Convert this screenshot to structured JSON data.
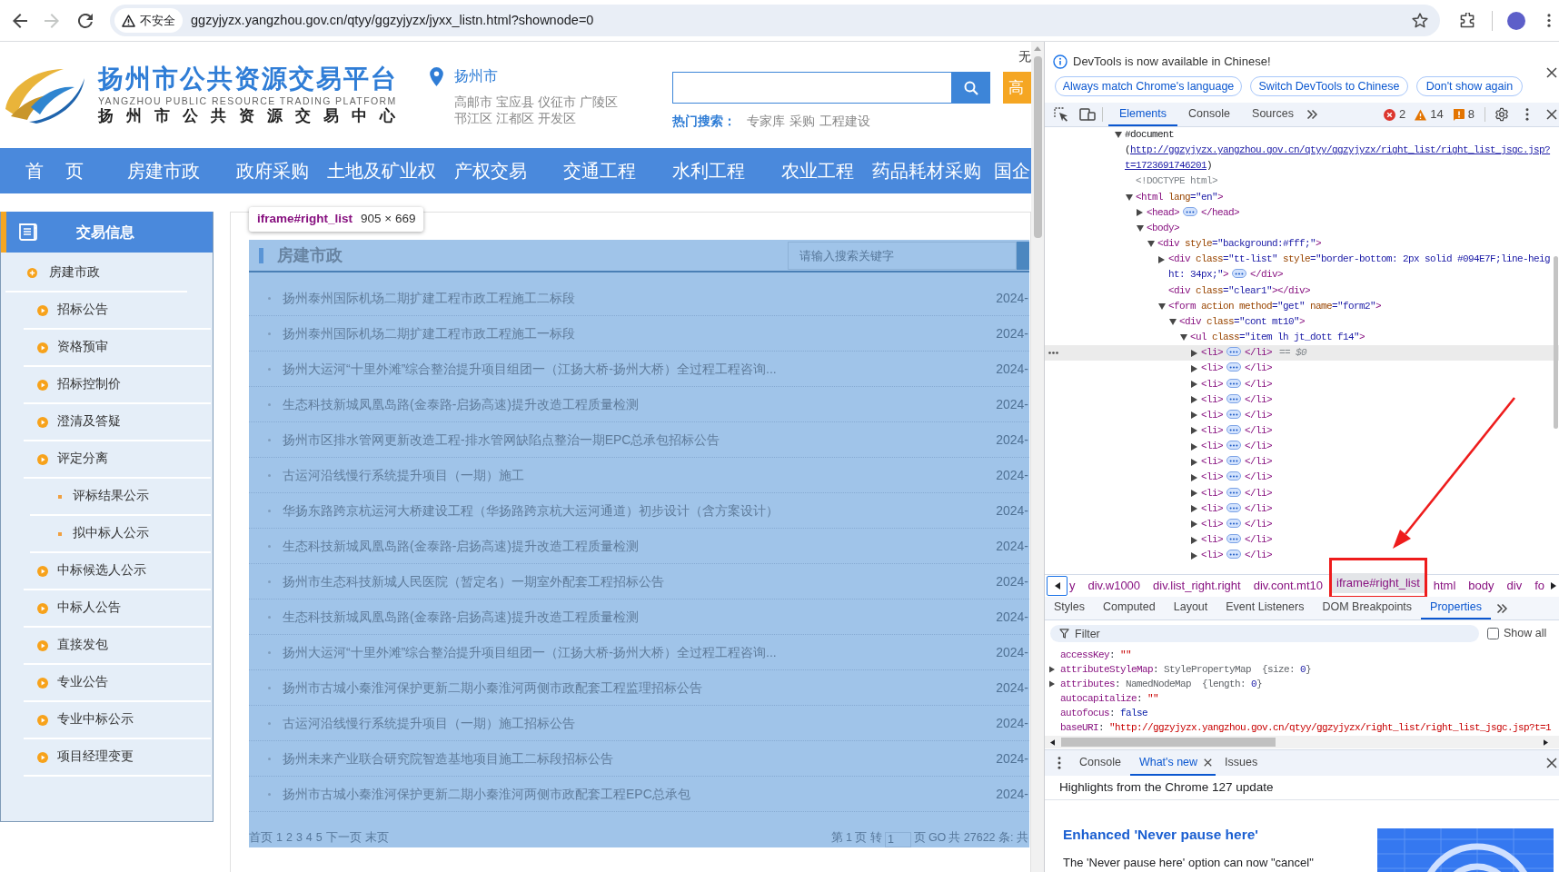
{
  "browser": {
    "forward_disabled": true,
    "security_label": "不安全",
    "url": "ggzyjyzx.yangzhou.gov.cn/qtyy/ggzyjyzx/jyxx_listn.html?shownode=0"
  },
  "site_header": {
    "title": "扬州市公共资源交易平台",
    "title_en": "YANGZHOU PUBLIC RESOURCE TRADING PLATFORM",
    "title_center": "扬州市公共资源交易中心",
    "city": "扬州市",
    "districts": [
      "高邮市",
      "宝应县",
      "仪征市",
      "广陵区",
      "邗江区",
      "江都区",
      "开发区"
    ],
    "corner_text": "无",
    "advanced_search_label": "高",
    "hot_search_label": "热门搜索：",
    "hot_search_terms": [
      "专家库",
      "采购",
      "工程建设"
    ]
  },
  "nav": [
    "首 页",
    "房建市政",
    "政府采购",
    "土地及矿业权",
    "产权交易",
    "交通工程",
    "水利工程",
    "农业工程",
    "药品耗材采购",
    "国企"
  ],
  "sidebar": {
    "title": "交易信息",
    "items": [
      {
        "label": "房建市政",
        "children": [
          {
            "label": "招标公告"
          },
          {
            "label": "资格预审"
          },
          {
            "label": "招标控制价"
          },
          {
            "label": "澄清及答疑"
          },
          {
            "label": "评定分离",
            "children": [
              {
                "label": "评标结果公示"
              },
              {
                "label": "拟中标人公示"
              }
            ]
          },
          {
            "label": "中标候选人公示"
          },
          {
            "label": "中标人公告"
          },
          {
            "label": "直接发包"
          },
          {
            "label": "专业公告"
          },
          {
            "label": "专业中标公示"
          },
          {
            "label": "项目经理变更"
          }
        ]
      }
    ]
  },
  "list_panel": {
    "inspect_tooltip": {
      "selector": "iframe#right_list",
      "size": "905 × 669"
    },
    "title": "房建市政",
    "search_placeholder": "请输入搜索关键字",
    "rows": [
      {
        "title": "扬州泰州国际机场二期扩建工程市政工程施工二标段",
        "date": "2024-"
      },
      {
        "title": "扬州泰州国际机场二期扩建工程市政工程施工一标段",
        "date": "2024-"
      },
      {
        "title": "扬州大运河“十里外滩”综合整治提升项目组团一（江扬大桥-扬州大桥）全过程工程咨询...",
        "date": "2024-"
      },
      {
        "title": "生态科技新城凤凰岛路(金泰路-启扬高速)提升改造工程质量检测",
        "date": "2024-"
      },
      {
        "title": "扬州市区排水管网更新改造工程-排水管网缺陷点整治一期EPC总承包招标公告",
        "date": "2024-"
      },
      {
        "title": "古运河沿线慢行系统提升项目（一期）施工",
        "date": "2024-"
      },
      {
        "title": "华扬东路跨京杭运河大桥建设工程（华扬路跨京杭大运河通道）初步设计（含方案设计）",
        "date": "2024-"
      },
      {
        "title": "生态科技新城凤凰岛路(金泰路-启扬高速)提升改造工程质量检测",
        "date": "2024-"
      },
      {
        "title": "扬州市生态科技新城人民医院（暂定名）一期室外配套工程招标公告",
        "date": "2024-"
      },
      {
        "title": "生态科技新城凤凰岛路(金泰路-启扬高速)提升改造工程质量检测",
        "date": "2024-"
      },
      {
        "title": "扬州大运河“十里外滩”综合整治提升项目组团一（江扬大桥-扬州大桥）全过程工程咨询...",
        "date": "2024-"
      },
      {
        "title": "扬州市古城小秦淮河保护更新二期小秦淮河两侧市政配套工程监理招标公告",
        "date": "2024-"
      },
      {
        "title": "古运河沿线慢行系统提升项目（一期）施工招标公告",
        "date": "2024-"
      },
      {
        "title": "扬州未来产业联合研究院智造基地项目施工二标段招标公告",
        "date": "2024-"
      },
      {
        "title": "扬州市古城小秦淮河保护更新二期小秦淮河两侧市政配套工程EPC总承包",
        "date": "2024-"
      }
    ],
    "pagination": {
      "pages": [
        "首页",
        "1",
        "2",
        "3",
        "4",
        "5",
        "下一页",
        "末页"
      ],
      "page_status": "第 1 页 转",
      "jump_value": "1",
      "jump_suffix": "页",
      "go_label": "GO",
      "total": "共 27622 条: 共"
    }
  },
  "devtools": {
    "notice": {
      "message": "DevTools is now available in Chinese!",
      "buttons": [
        "Always match Chrome's language",
        "Switch DevTools to Chinese",
        "Don't show again"
      ]
    },
    "tabs": [
      {
        "label": "Elements",
        "selected": true
      },
      {
        "label": "Console",
        "selected": false
      },
      {
        "label": "Sources",
        "selected": false
      }
    ],
    "issue_counts": [
      {
        "kind": "error",
        "count": "2"
      },
      {
        "kind": "warning",
        "count": "14"
      },
      {
        "kind": "issue",
        "count": "8"
      }
    ],
    "dom_tree": [
      {
        "selected": false,
        "expanded": true,
        "tokens": [
          {
            "kind": "plain",
            "text": "#document"
          },
          {
            "kind": "break"
          },
          {
            "kind": "plain",
            "text": "("
          },
          {
            "kind": "link",
            "text": "http://ggzyjyzx.yangzhou.gov.cn/qtyy/ggzyjyzx/right_list/right_list_jsgc.jsp?t=1723691746201"
          },
          {
            "kind": "plain",
            "text": ")"
          }
        ],
        "children": [
          {
            "selected": false,
            "tokens": [
              {
                "kind": "doctype",
                "text": "<!DOCTYPE html>"
              }
            ]
          },
          {
            "selected": false,
            "expanded": true,
            "tokens": [
              {
                "kind": "tag",
                "text": "<html"
              },
              {
                "kind": "attr",
                "text": " lang"
              },
              {
                "kind": "value",
                "text": "=\"en\""
              },
              {
                "kind": "tag",
                "text": ">"
              }
            ],
            "children": [
              {
                "selected": false,
                "expanded": false,
                "tokens": [
                  {
                    "kind": "tag",
                    "text": "<head>"
                  },
                  {
                    "kind": "ellipsis"
                  },
                  {
                    "kind": "tag",
                    "text": "</head>"
                  }
                ]
              },
              {
                "selected": false,
                "expanded": true,
                "tokens": [
                  {
                    "kind": "tag",
                    "text": "<body>"
                  }
                ],
                "children": [
                  {
                    "selected": false,
                    "expanded": true,
                    "tokens": [
                      {
                        "kind": "tag",
                        "text": "<div"
                      },
                      {
                        "kind": "attr",
                        "text": " style"
                      },
                      {
                        "kind": "value",
                        "text": "=\"background:#fff;\""
                      },
                      {
                        "kind": "tag",
                        "text": ">"
                      }
                    ],
                    "children": [
                      {
                        "selected": false,
                        "expanded": false,
                        "tokens": [
                          {
                            "kind": "tag",
                            "text": "<div"
                          },
                          {
                            "kind": "attr",
                            "text": " class"
                          },
                          {
                            "kind": "value",
                            "text": "=\"tt-list\""
                          },
                          {
                            "kind": "attr",
                            "text": " style"
                          },
                          {
                            "kind": "value",
                            "text": "=\"border-bottom: 2px solid #094E7F;line-height: 34px;\""
                          },
                          {
                            "kind": "tag",
                            "text": ">"
                          },
                          {
                            "kind": "ellipsis"
                          },
                          {
                            "kind": "tag",
                            "text": "</div>"
                          }
                        ]
                      },
                      {
                        "selected": false,
                        "tokens": [
                          {
                            "kind": "tag",
                            "text": "<div"
                          },
                          {
                            "kind": "attr",
                            "text": " class"
                          },
                          {
                            "kind": "value",
                            "text": "=\"clear1\""
                          },
                          {
                            "kind": "tag",
                            "text": "></div>"
                          }
                        ]
                      },
                      {
                        "selected": false,
                        "expanded": true,
                        "tokens": [
                          {
                            "kind": "tag",
                            "text": "<form"
                          },
                          {
                            "kind": "attr",
                            "text": " action method"
                          },
                          {
                            "kind": "value",
                            "text": "=\"get\""
                          },
                          {
                            "kind": "attr",
                            "text": " name"
                          },
                          {
                            "kind": "value",
                            "text": "=\"form2\""
                          },
                          {
                            "kind": "tag",
                            "text": ">"
                          }
                        ],
                        "children": [
                          {
                            "selected": false,
                            "expanded": true,
                            "tokens": [
                              {
                                "kind": "tag",
                                "text": "<div"
                              },
                              {
                                "kind": "attr",
                                "text": " class"
                              },
                              {
                                "kind": "value",
                                "text": "=\"cont mt10\""
                              },
                              {
                                "kind": "tag",
                                "text": ">"
                              }
                            ],
                            "children": [
                              {
                                "selected": false,
                                "expanded": true,
                                "tokens": [
                                  {
                                    "kind": "tag",
                                    "text": "<ul"
                                  },
                                  {
                                    "kind": "attr",
                                    "text": " class"
                                  },
                                  {
                                    "kind": "value",
                                    "text": "=\"item lh jt_dott f14\""
                                  },
                                  {
                                    "kind": "tag",
                                    "text": ">"
                                  }
                                ],
                                "children": [
                                  {
                                    "selected": true,
                                    "expanded": false,
                                    "tokens": [
                                      {
                                        "kind": "tag",
                                        "text": "<li>"
                                      },
                                      {
                                        "kind": "ellipsis"
                                      },
                                      {
                                        "kind": "tag",
                                        "text": "</li>"
                                      },
                                      {
                                        "kind": "ref",
                                        "text": "== $0"
                                      }
                                    ]
                                  },
                                  {
                                    "selected": false,
                                    "expanded": false,
                                    "tokens": [
                                      {
                                        "kind": "tag",
                                        "text": "<li>"
                                      },
                                      {
                                        "kind": "ellipsis"
                                      },
                                      {
                                        "kind": "tag",
                                        "text": "</li>"
                                      }
                                    ]
                                  },
                                  {
                                    "selected": false,
                                    "expanded": false,
                                    "tokens": [
                                      {
                                        "kind": "tag",
                                        "text": "<li>"
                                      },
                                      {
                                        "kind": "ellipsis"
                                      },
                                      {
                                        "kind": "tag",
                                        "text": "</li>"
                                      }
                                    ]
                                  },
                                  {
                                    "selected": false,
                                    "expanded": false,
                                    "tokens": [
                                      {
                                        "kind": "tag",
                                        "text": "<li>"
                                      },
                                      {
                                        "kind": "ellipsis"
                                      },
                                      {
                                        "kind": "tag",
                                        "text": "</li>"
                                      }
                                    ]
                                  },
                                  {
                                    "selected": false,
                                    "expanded": false,
                                    "tokens": [
                                      {
                                        "kind": "tag",
                                        "text": "<li>"
                                      },
                                      {
                                        "kind": "ellipsis"
                                      },
                                      {
                                        "kind": "tag",
                                        "text": "</li>"
                                      }
                                    ]
                                  },
                                  {
                                    "selected": false,
                                    "expanded": false,
                                    "tokens": [
                                      {
                                        "kind": "tag",
                                        "text": "<li>"
                                      },
                                      {
                                        "kind": "ellipsis"
                                      },
                                      {
                                        "kind": "tag",
                                        "text": "</li>"
                                      }
                                    ]
                                  },
                                  {
                                    "selected": false,
                                    "expanded": false,
                                    "tokens": [
                                      {
                                        "kind": "tag",
                                        "text": "<li>"
                                      },
                                      {
                                        "kind": "ellipsis"
                                      },
                                      {
                                        "kind": "tag",
                                        "text": "</li>"
                                      }
                                    ]
                                  },
                                  {
                                    "selected": false,
                                    "expanded": false,
                                    "tokens": [
                                      {
                                        "kind": "tag",
                                        "text": "<li>"
                                      },
                                      {
                                        "kind": "ellipsis"
                                      },
                                      {
                                        "kind": "tag",
                                        "text": "</li>"
                                      }
                                    ]
                                  },
                                  {
                                    "selected": false,
                                    "expanded": false,
                                    "tokens": [
                                      {
                                        "kind": "tag",
                                        "text": "<li>"
                                      },
                                      {
                                        "kind": "ellipsis"
                                      },
                                      {
                                        "kind": "tag",
                                        "text": "</li>"
                                      }
                                    ]
                                  },
                                  {
                                    "selected": false,
                                    "expanded": false,
                                    "tokens": [
                                      {
                                        "kind": "tag",
                                        "text": "<li>"
                                      },
                                      {
                                        "kind": "ellipsis"
                                      },
                                      {
                                        "kind": "tag",
                                        "text": "</li>"
                                      }
                                    ]
                                  },
                                  {
                                    "selected": false,
                                    "expanded": false,
                                    "tokens": [
                                      {
                                        "kind": "tag",
                                        "text": "<li>"
                                      },
                                      {
                                        "kind": "ellipsis"
                                      },
                                      {
                                        "kind": "tag",
                                        "text": "</li>"
                                      }
                                    ]
                                  },
                                  {
                                    "selected": false,
                                    "expanded": false,
                                    "tokens": [
                                      {
                                        "kind": "tag",
                                        "text": "<li>"
                                      },
                                      {
                                        "kind": "ellipsis"
                                      },
                                      {
                                        "kind": "tag",
                                        "text": "</li>"
                                      }
                                    ]
                                  },
                                  {
                                    "selected": false,
                                    "expanded": false,
                                    "tokens": [
                                      {
                                        "kind": "tag",
                                        "text": "<li>"
                                      },
                                      {
                                        "kind": "ellipsis"
                                      },
                                      {
                                        "kind": "tag",
                                        "text": "</li>"
                                      }
                                    ]
                                  },
                                  {
                                    "selected": false,
                                    "expanded": false,
                                    "tokens": [
                                      {
                                        "kind": "tag",
                                        "text": "<li>"
                                      },
                                      {
                                        "kind": "ellipsis"
                                      },
                                      {
                                        "kind": "tag",
                                        "text": "</li>"
                                      }
                                    ]
                                  }
                                ]
                              }
                            ]
                          }
                        ]
                      }
                    ]
                  }
                ]
              }
            ]
          }
        ]
      }
    ],
    "breadcrumbs": [
      {
        "label": "y",
        "selected": false
      },
      {
        "label": "div.w1000",
        "selected": false
      },
      {
        "label": "div.list_right.right",
        "selected": false
      },
      {
        "label": "div.cont.mt10",
        "selected": false
      },
      {
        "label": "iframe#right_list",
        "selected": true
      },
      {
        "label": "html",
        "selected": false
      },
      {
        "label": "body",
        "selected": false
      },
      {
        "label": "div",
        "selected": false
      },
      {
        "label": "fo",
        "selected": false
      }
    ],
    "panel_tabs": [
      {
        "label": "Styles",
        "selected": false
      },
      {
        "label": "Computed",
        "selected": false
      },
      {
        "label": "Layout",
        "selected": false
      },
      {
        "label": "Event Listeners",
        "selected": false
      },
      {
        "label": "DOM Breakpoints",
        "selected": false
      },
      {
        "label": "Properties",
        "selected": true
      }
    ],
    "filter": {
      "placeholder": "Filter",
      "show_all_label": "Show all",
      "show_all_checked": false
    },
    "properties": [
      {
        "tokens": [
          {
            "kind": "name",
            "text": "accessKey"
          },
          {
            "kind": "punct",
            "text": ": "
          },
          {
            "kind": "string",
            "text": "\"\""
          }
        ]
      },
      {
        "expanded": false,
        "tokens": [
          {
            "kind": "name",
            "text": "attributeStyleMap"
          },
          {
            "kind": "punct",
            "text": ": "
          },
          {
            "kind": "type",
            "text": "StylePropertyMap  {size: "
          },
          {
            "kind": "number",
            "text": "0"
          },
          {
            "kind": "type",
            "text": "}"
          }
        ]
      },
      {
        "expanded": false,
        "tokens": [
          {
            "kind": "name",
            "text": "attributes"
          },
          {
            "kind": "punct",
            "text": ": "
          },
          {
            "kind": "type",
            "text": "NamedNodeMap  {length: "
          },
          {
            "kind": "number",
            "text": "0"
          },
          {
            "kind": "type",
            "text": "}"
          }
        ]
      },
      {
        "tokens": [
          {
            "kind": "name",
            "text": "autocapitalize"
          },
          {
            "kind": "punct",
            "text": ": "
          },
          {
            "kind": "string",
            "text": "\"\""
          }
        ]
      },
      {
        "tokens": [
          {
            "kind": "name",
            "text": "autofocus"
          },
          {
            "kind": "punct",
            "text": ": "
          },
          {
            "kind": "keyword",
            "text": "false"
          }
        ]
      },
      {
        "tokens": [
          {
            "kind": "name",
            "text": "baseURI"
          },
          {
            "kind": "punct",
            "text": ": "
          },
          {
            "kind": "string",
            "text": "\"http://ggzyjyzx.yangzhou.gov.cn/qtyy/ggzyjyzx/right_list/right_list_jsgc.jsp?t=1"
          }
        ]
      }
    ],
    "drawer_tabs": [
      {
        "label": "Console",
        "selected": false,
        "closable": false
      },
      {
        "label": "What's new",
        "selected": true,
        "closable": true
      },
      {
        "label": "Issues",
        "selected": false,
        "closable": false
      }
    ],
    "whats_new": {
      "headline": "Highlights from the Chrome 127 update",
      "article_title": "Enhanced 'Never pause here'",
      "article_text": "The 'Never pause here' option can now \"cancel\""
    }
  }
}
